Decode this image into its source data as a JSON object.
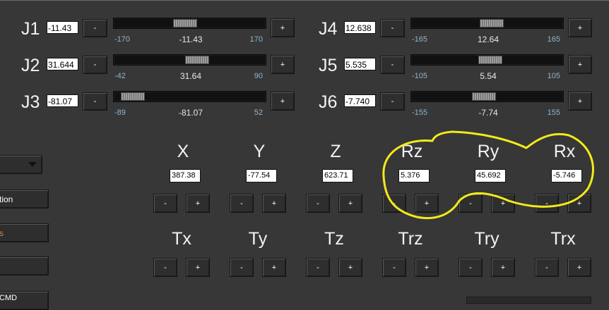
{
  "joints": [
    {
      "id": "J1",
      "label": "J1",
      "field_value": "-11.43",
      "min": "-170",
      "current": "-11.43",
      "max": "170",
      "level": 0.4664
    },
    {
      "id": "J2",
      "label": "J2",
      "field_value": "31.644",
      "min": "-42",
      "current": "31.64",
      "max": "90",
      "level": 0.5579
    },
    {
      "id": "J3",
      "label": "J3",
      "field_value": "-81.07",
      "min": "-89",
      "current": "-81.07",
      "max": "52",
      "level": 0.0562
    },
    {
      "id": "J4",
      "label": "J4",
      "field_value": "12.638",
      "min": "-165",
      "current": "12.64",
      "max": "165",
      "level": 0.5383
    },
    {
      "id": "J5",
      "label": "J5",
      "field_value": "5.535",
      "min": "-105",
      "current": "5.54",
      "max": "105",
      "level": 0.5264
    },
    {
      "id": "J6",
      "label": "J6",
      "field_value": "-7.740",
      "min": "-155",
      "current": "-7.74",
      "max": "155",
      "level": 0.475
    }
  ],
  "buttons": {
    "minus": "-",
    "plus": "+"
  },
  "pose": [
    {
      "label": "X",
      "value": "387.38"
    },
    {
      "label": "Y",
      "value": "-77.54"
    },
    {
      "label": "Z",
      "value": "623.71"
    },
    {
      "label": "Rz",
      "value": "5.376"
    },
    {
      "label": "Ry",
      "value": "45.692"
    },
    {
      "label": "Rx",
      "value": "-5.746"
    }
  ],
  "tool": [
    {
      "label": "Tx"
    },
    {
      "label": "Ty"
    },
    {
      "label": "Tz"
    },
    {
      "label": "Trz"
    },
    {
      "label": "Try"
    },
    {
      "label": "Trx"
    }
  ],
  "left_panel": {
    "dropdown_value": "",
    "button1": "tion",
    "button2": "s",
    "button3": "",
    "button4": "CMD"
  },
  "colors": {
    "background": "#373737",
    "annotation": "#f2ea1a",
    "tick_text": "#8fb4cf",
    "button2_text": "#d8823a"
  }
}
